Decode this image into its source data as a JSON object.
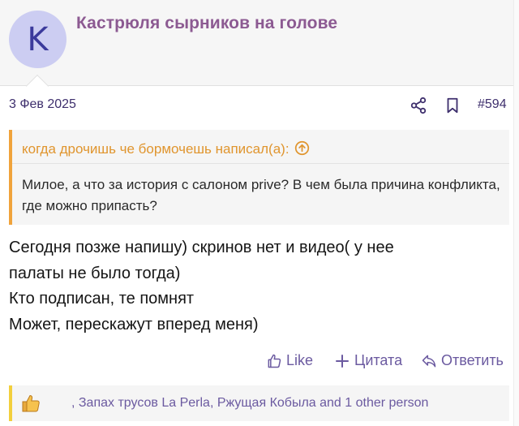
{
  "user": {
    "avatar_letter": "K",
    "username": "Кастрюля сырников на голове"
  },
  "post": {
    "date": "3 Фев 2025",
    "number": "#594",
    "icons": [
      "share-icon",
      "bookmark-icon"
    ]
  },
  "quote": {
    "author_line": "когда дрочишь че бормочешь написал(а):",
    "text": "Милое, а что за история с салоном prive? В чем была причина конфликта, где можно припасть?"
  },
  "message": {
    "lines": [
      "Сегодня позже напишу) скринов нет и видео( у нее",
      "палаты не было тогда)",
      "Кто подписан, те помнят",
      "Может, перескажут вперед меня)"
    ]
  },
  "actions": {
    "like_label": "Like",
    "quote_label": "Цитата",
    "reply_label": "Ответить"
  },
  "reactions": {
    "icon": "thumbs-up-icon",
    "text": ", Запах трусов La Perla, Ржущая Кобыла and 1 other person"
  },
  "colors": {
    "username": "#8c5a92",
    "quote_accent": "#f0a33b",
    "reaction_accent": "#f2cf3c",
    "link": "#6b5aa0",
    "avatar_bg": "#cccdf2"
  }
}
